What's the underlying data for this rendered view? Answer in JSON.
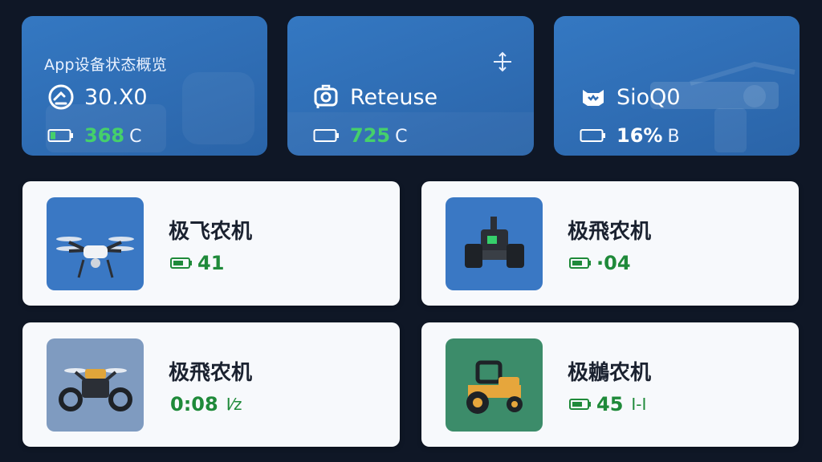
{
  "status_cards": [
    {
      "title": "App设备状态概览",
      "icon": "speedometer-icon",
      "main_text": "30.X0",
      "battery_value": "368",
      "battery_unit": "C",
      "battery_color": "#45d06b"
    },
    {
      "icon": "camera-icon",
      "corner_icon": "move-arrows-icon",
      "main_text": "Reteuse",
      "battery_value": "725",
      "battery_unit": "C",
      "battery_color": "#45d06b"
    },
    {
      "icon": "robot-icon",
      "main_text": "SioQ0",
      "battery_value": "16%",
      "battery_unit": "B",
      "battery_color": "#ffffff"
    }
  ],
  "devices": [
    {
      "name": "极飞农机",
      "battery_text": "41",
      "battery_unit": "",
      "thumb_bg": "#3a78c4",
      "icon": "drone-icon"
    },
    {
      "name": "极飛农机",
      "battery_text": "·04",
      "battery_unit": "",
      "thumb_bg": "#3a78c4",
      "icon": "robot-tractor-icon"
    },
    {
      "name": "极飛农机",
      "battery_text": "0:08",
      "battery_unit": "I⁄z",
      "thumb_bg": "#7f9bc0",
      "icon": "drone-rover-icon"
    },
    {
      "name": "极鶒农机",
      "battery_text": "45",
      "battery_unit": "I-I",
      "thumb_bg": "#3c8c6a",
      "icon": "tractor-icon"
    }
  ]
}
